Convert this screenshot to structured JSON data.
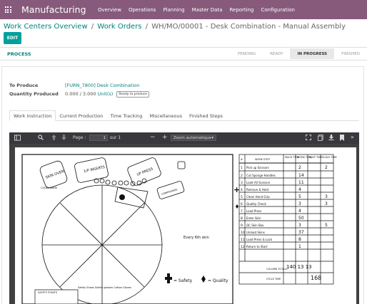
{
  "nav": {
    "brand": "Manufacturing",
    "menu": [
      "Overview",
      "Operations",
      "Planning",
      "Master Data",
      "Reporting",
      "Configuration"
    ]
  },
  "breadcrumb": {
    "item1": "Work Centers Overview",
    "item2": "Work Orders",
    "current": "WH/MO/00001 - Desk Combination - Manual Assembly",
    "separator": "/"
  },
  "actions": {
    "edit": "EDIT",
    "process": "PROCESS"
  },
  "stages": [
    "PENDING",
    "READY",
    "IN PROGRESS",
    "FINISHED"
  ],
  "form": {
    "to_produce_label": "To Produce",
    "to_produce_value": "[FURN_7800] Desk Combination",
    "qty_label": "Quantity Produced",
    "qty_value": "0.000 / 3.000",
    "qty_unit": "Unit(s)",
    "qty_badge": "Ready to produce"
  },
  "tabs": [
    "Work Instruction",
    "Current Production",
    "Time Tracking",
    "Miscellaneous",
    "Finished Steps"
  ],
  "viewer": {
    "page_label": "Page :",
    "page_value": "1",
    "page_total": "sur 1",
    "zoom": "Zoom automatique",
    "zoom_out": "−",
    "zoom_in": "+"
  },
  "drawing": {
    "stations": [
      "SKIN OVEN",
      "1/P INSERTS",
      "I/P PRESS",
      "CLEAN SKINS",
      "COMPOUNDS"
    ],
    "safety_note": "SAFETY POINTS",
    "safety_box": "Safety Shoes Safety glasses Cotton Gloves",
    "every_note": "Every 6th skin",
    "legend_safety": "= Safety",
    "legend_quality": "= Quality",
    "table_headers": [
      "#",
      "WORK STEP",
      "MACH TIME",
      "WORK TIME",
      "WAIT TIME",
      "SCALE TIME"
    ],
    "steps": [
      {
        "n": "1",
        "step": "Pick up Scissors",
        "mach": "",
        "work": "2",
        "wait": "",
        "scale": "2"
      },
      {
        "n": "2",
        "step": "Cut Sponge Handles",
        "mach": "",
        "work": "14",
        "wait": "",
        "scale": ""
      },
      {
        "n": "3",
        "step": "Load All Scissors",
        "mach": "",
        "work": "11",
        "wait": "",
        "scale": ""
      },
      {
        "n": "4",
        "step": "Remove & Hold",
        "mach": "",
        "work": "4",
        "wait": "",
        "scale": ""
      },
      {
        "n": "5",
        "step": "Clean Hand Grip",
        "mach": "",
        "work": "5",
        "wait": "",
        "scale": "3"
      },
      {
        "n": "6",
        "step": "Quality Check",
        "mach": "",
        "work": "3",
        "wait": "",
        "scale": "3"
      },
      {
        "n": "7",
        "step": "Load Press",
        "mach": "",
        "work": "4",
        "wait": "",
        "scale": ""
      },
      {
        "n": "8",
        "step": "Enter Skin",
        "mach": "",
        "work": "50",
        "wait": "",
        "scale": ""
      },
      {
        "n": "9",
        "step": "QC Skin Box",
        "mach": "",
        "work": "3",
        "wait": "",
        "scale": "5"
      },
      {
        "n": "10",
        "step": "Unload Skins",
        "mach": "",
        "work": "37",
        "wait": "",
        "scale": ""
      },
      {
        "n": "11",
        "step": "Load Press & Lock",
        "mach": "",
        "work": "8",
        "wait": "",
        "scale": ""
      },
      {
        "n": "12",
        "step": "Return to Start",
        "mach": "",
        "work": "1",
        "wait": "",
        "scale": ""
      }
    ],
    "column_totals_label": "COLUMN TOTALS",
    "cycle_time_label": "CYCLE TIME",
    "totals": "140  13  13",
    "cycle_time": "168"
  },
  "colors": {
    "brand": "#875a7b",
    "link": "#00827a",
    "edit": "#00a09d"
  }
}
